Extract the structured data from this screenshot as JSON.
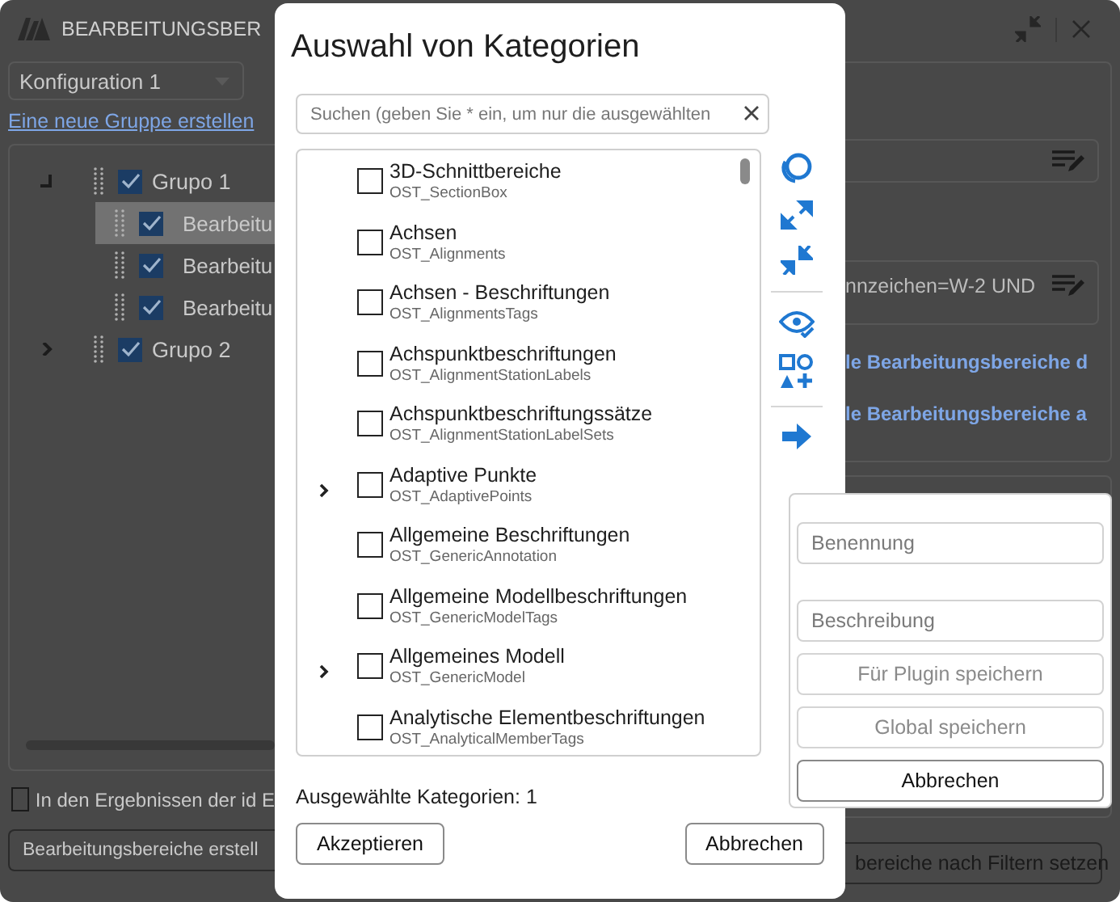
{
  "window": {
    "title": "BEARBEITUNGSBER"
  },
  "config_select": {
    "value": "Konfiguration 1"
  },
  "new_group_link": "Eine neue Gruppe erstellen",
  "groups": [
    {
      "label": "Grupo 1",
      "checked": true,
      "expanded": true,
      "children": [
        {
          "label": "Bearbeitu",
          "checked": true,
          "selected": true
        },
        {
          "label": "Bearbeitu",
          "checked": true,
          "selected": false
        },
        {
          "label": "Bearbeitu",
          "checked": true,
          "selected": false
        }
      ]
    },
    {
      "label": "Grupo 2",
      "checked": true,
      "expanded": false
    }
  ],
  "results_checkbox": {
    "label": "In den Ergebnissen der id E",
    "checked": false
  },
  "create_button": "Bearbeitungsbereiche erstell",
  "filter_field": {
    "value": "nnzeichen=W-2 UND"
  },
  "links": [
    "le Bearbeitungsbereiche d",
    "le Bearbeitungsbereiche a"
  ],
  "set_button": "bereiche nach Filtern setzen",
  "dialog": {
    "title": "Auswahl von Kategorien",
    "search": {
      "placeholder": "Suchen (geben Sie * ein, um nur die ausgewählten"
    },
    "categories": [
      {
        "name": "3D-Schnittbereiche",
        "code": "OST_SectionBox",
        "checked": false,
        "expandable": false
      },
      {
        "name": "Achsen",
        "code": "OST_Alignments",
        "checked": false,
        "expandable": false
      },
      {
        "name": "Achsen - Beschriftungen",
        "code": "OST_AlignmentsTags",
        "checked": false,
        "expandable": false
      },
      {
        "name": "Achspunktbeschriftungen",
        "code": "OST_AlignmentStationLabels",
        "checked": false,
        "expandable": false
      },
      {
        "name": "Achspunktbeschriftungssätze",
        "code": "OST_AlignmentStationLabelSets",
        "checked": false,
        "expandable": false
      },
      {
        "name": "Adaptive Punkte",
        "code": "OST_AdaptivePoints",
        "checked": false,
        "expandable": true
      },
      {
        "name": "Allgemeine Beschriftungen",
        "code": "OST_GenericAnnotation",
        "checked": false,
        "expandable": false
      },
      {
        "name": "Allgemeine Modellbeschriftungen",
        "code": "OST_GenericModelTags",
        "checked": false,
        "expandable": false
      },
      {
        "name": "Allgemeines Modell",
        "code": "OST_GenericModel",
        "checked": false,
        "expandable": true
      },
      {
        "name": "Analytische Elementbeschriftungen",
        "code": "OST_AnalyticalMemberTags",
        "checked": false,
        "expandable": false
      }
    ],
    "selected_count": "Ausgewählte Kategorien: 1",
    "buttons": [
      "Akzeptieren",
      "Abbrechen"
    ]
  },
  "save_panel": {
    "name_placeholder": "Benennung",
    "description_placeholder": "Beschreibung",
    "buttons": [
      {
        "label": "Für Plugin speichern",
        "disabled": true
      },
      {
        "label": "Global speichern",
        "disabled": true
      },
      {
        "label": "Abbrechen",
        "disabled": false
      }
    ]
  }
}
